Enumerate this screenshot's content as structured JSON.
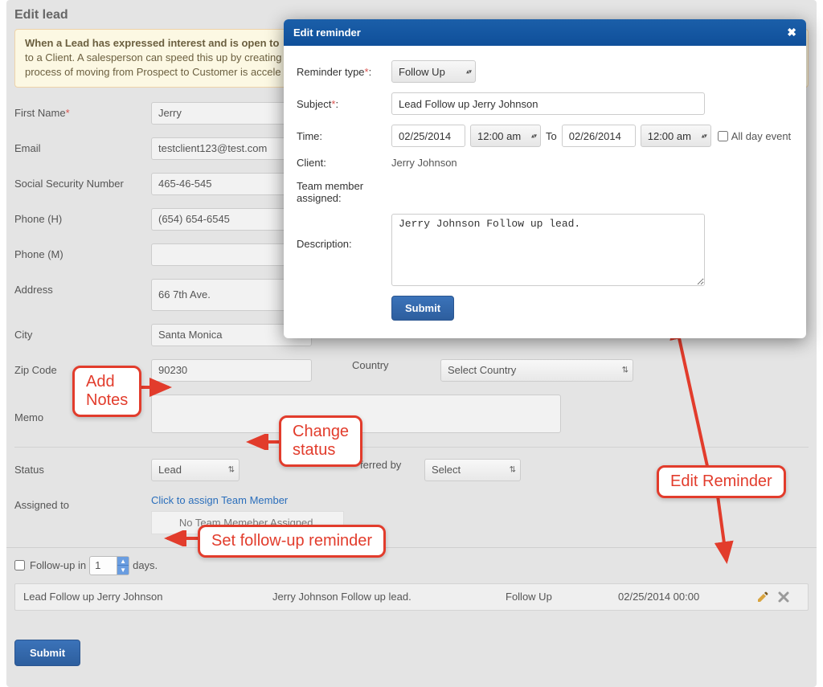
{
  "page_title": "Edit lead",
  "info_box": {
    "bold": "When a Lead has expressed interest and is open to",
    "rest_line1": "to a Client. A salesperson can speed this up by creating",
    "rest_line2": "process of moving from Prospect to Customer is accele"
  },
  "fields": {
    "first_name_label": "First Name",
    "first_name_value": "Jerry",
    "email_label": "Email",
    "email_value": "testclient123@test.com",
    "ssn_label": "Social Security Number",
    "ssn_value": "465-46-545",
    "phone_h_label": "Phone (H)",
    "phone_h_value": "(654) 654-6545",
    "phone_m_label": "Phone (M)",
    "phone_m_value": "",
    "address_label": "Address",
    "address_value": "66 7th Ave.",
    "city_label": "City",
    "city_value": "Santa Monica",
    "zip_label": "Zip Code",
    "zip_value": "90230",
    "country_label": "Country",
    "country_value": "Select Country",
    "memo_label": "Memo",
    "memo_value": "",
    "status_label": "Status",
    "status_value": "Lead",
    "referred_label": "ferred by",
    "referred_value": "Select",
    "assigned_label": "Assigned to",
    "assigned_link": "Click to assign Team Member",
    "no_team": "No Team Memeber Assigned."
  },
  "followup": {
    "checkbox_label_pre": "Follow-up in",
    "days_value": "1",
    "checkbox_label_post": "days."
  },
  "reminder_row": {
    "subject": "Lead Follow up Jerry Johnson",
    "desc": "Jerry Johnson Follow up lead.",
    "type": "Follow Up",
    "datetime": "02/25/2014 00:00"
  },
  "submit_label": "Submit",
  "callouts": {
    "add_notes_l1": "Add",
    "add_notes_l2": "Notes",
    "change_status_l1": "Change",
    "change_status_l2": "status",
    "set_followup": "Set follow-up reminder",
    "edit_reminder": "Edit Reminder"
  },
  "modal": {
    "title": "Edit reminder",
    "reminder_type_label": "Reminder type",
    "reminder_type_value": "Follow Up",
    "subject_label": "Subject",
    "subject_value": "Lead Follow up Jerry Johnson",
    "time_label": "Time:",
    "start_date": "02/25/2014",
    "start_time": "12:00 am",
    "to_label": "To",
    "end_date": "02/26/2014",
    "end_time": "12:00 am",
    "allday_label": "All day event",
    "client_label": "Client:",
    "client_value": "Jerry Johnson",
    "team_label_l1": "Team member",
    "team_label_l2": "assigned:",
    "description_label": "Description:",
    "description_value": "Jerry Johnson Follow up lead.",
    "submit_label": "Submit"
  }
}
